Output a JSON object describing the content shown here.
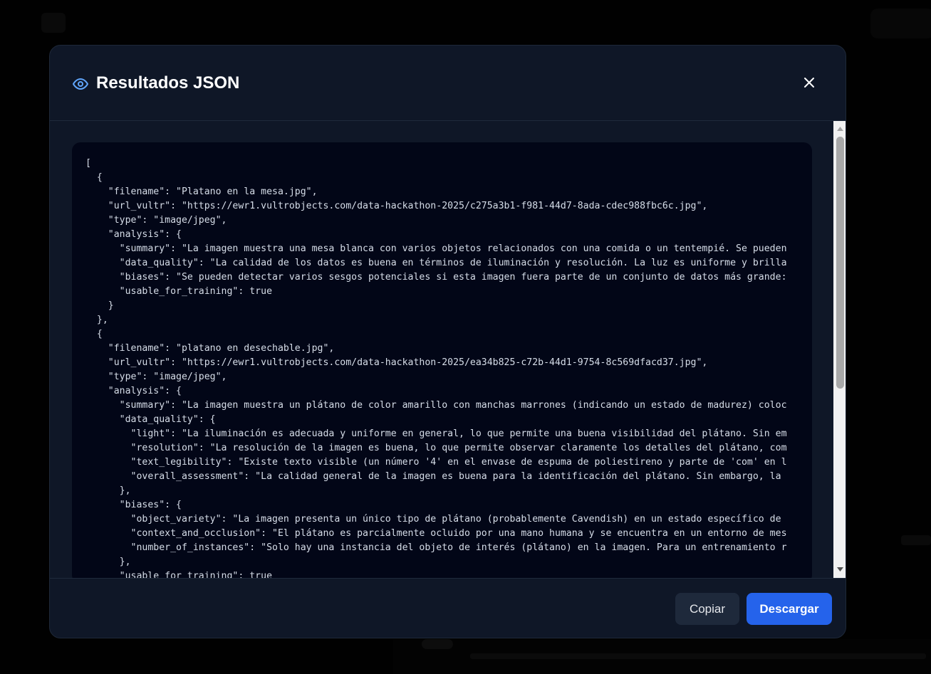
{
  "modal": {
    "title": "Resultados JSON",
    "title_icon": "eye-icon",
    "close_icon": "close-icon"
  },
  "code": {
    "lines": [
      "[",
      "  {",
      "    \"filename\": \"Platano en la mesa.jpg\",",
      "    \"url_vultr\": \"https://ewr1.vultrobjects.com/data-hackathon-2025/c275a3b1-f981-44d7-8ada-cdec988fbc6c.jpg\",",
      "    \"type\": \"image/jpeg\",",
      "    \"analysis\": {",
      "      \"summary\": \"La imagen muestra una mesa blanca con varios objetos relacionados con una comida o un tentempié. Se pueden",
      "      \"data_quality\": \"La calidad de los datos es buena en términos de iluminación y resolución. La luz es uniforme y brilla",
      "      \"biases\": \"Se pueden detectar varios sesgos potenciales si esta imagen fuera parte de un conjunto de datos más grande:",
      "      \"usable_for_training\": true",
      "    }",
      "  },",
      "  {",
      "    \"filename\": \"platano en desechable.jpg\",",
      "    \"url_vultr\": \"https://ewr1.vultrobjects.com/data-hackathon-2025/ea34b825-c72b-44d1-9754-8c569dfacd37.jpg\",",
      "    \"type\": \"image/jpeg\",",
      "    \"analysis\": {",
      "      \"summary\": \"La imagen muestra un plátano de color amarillo con manchas marrones (indicando un estado de madurez) coloc",
      "      \"data_quality\": {",
      "        \"light\": \"La iluminación es adecuada y uniforme en general, lo que permite una buena visibilidad del plátano. Sin em",
      "        \"resolution\": \"La resolución de la imagen es buena, lo que permite observar claramente los detalles del plátano, com",
      "        \"text_legibility\": \"Existe texto visible (un número '4' en el envase de espuma de poliestireno y parte de 'com' en l",
      "        \"overall_assessment\": \"La calidad general de la imagen es buena para la identificación del plátano. Sin embargo, la",
      "      },",
      "      \"biases\": {",
      "        \"object_variety\": \"La imagen presenta un único tipo de plátano (probablemente Cavendish) en un estado específico de",
      "        \"context_and_occlusion\": \"El plátano es parcialmente ocluido por una mano humana y se encuentra en un entorno de mes",
      "        \"number_of_instances\": \"Solo hay una instancia del objeto de interés (plátano) en la imagen. Para un entrenamiento r",
      "      },",
      "      \"usable_for_training\": true"
    ]
  },
  "footer": {
    "copy_label": "Copiar",
    "download_label": "Descargar"
  },
  "colors": {
    "modal_bg": "#0f1727",
    "code_bg": "#020617",
    "accent": "#2563eb",
    "icon_blue": "#60a5fa"
  }
}
